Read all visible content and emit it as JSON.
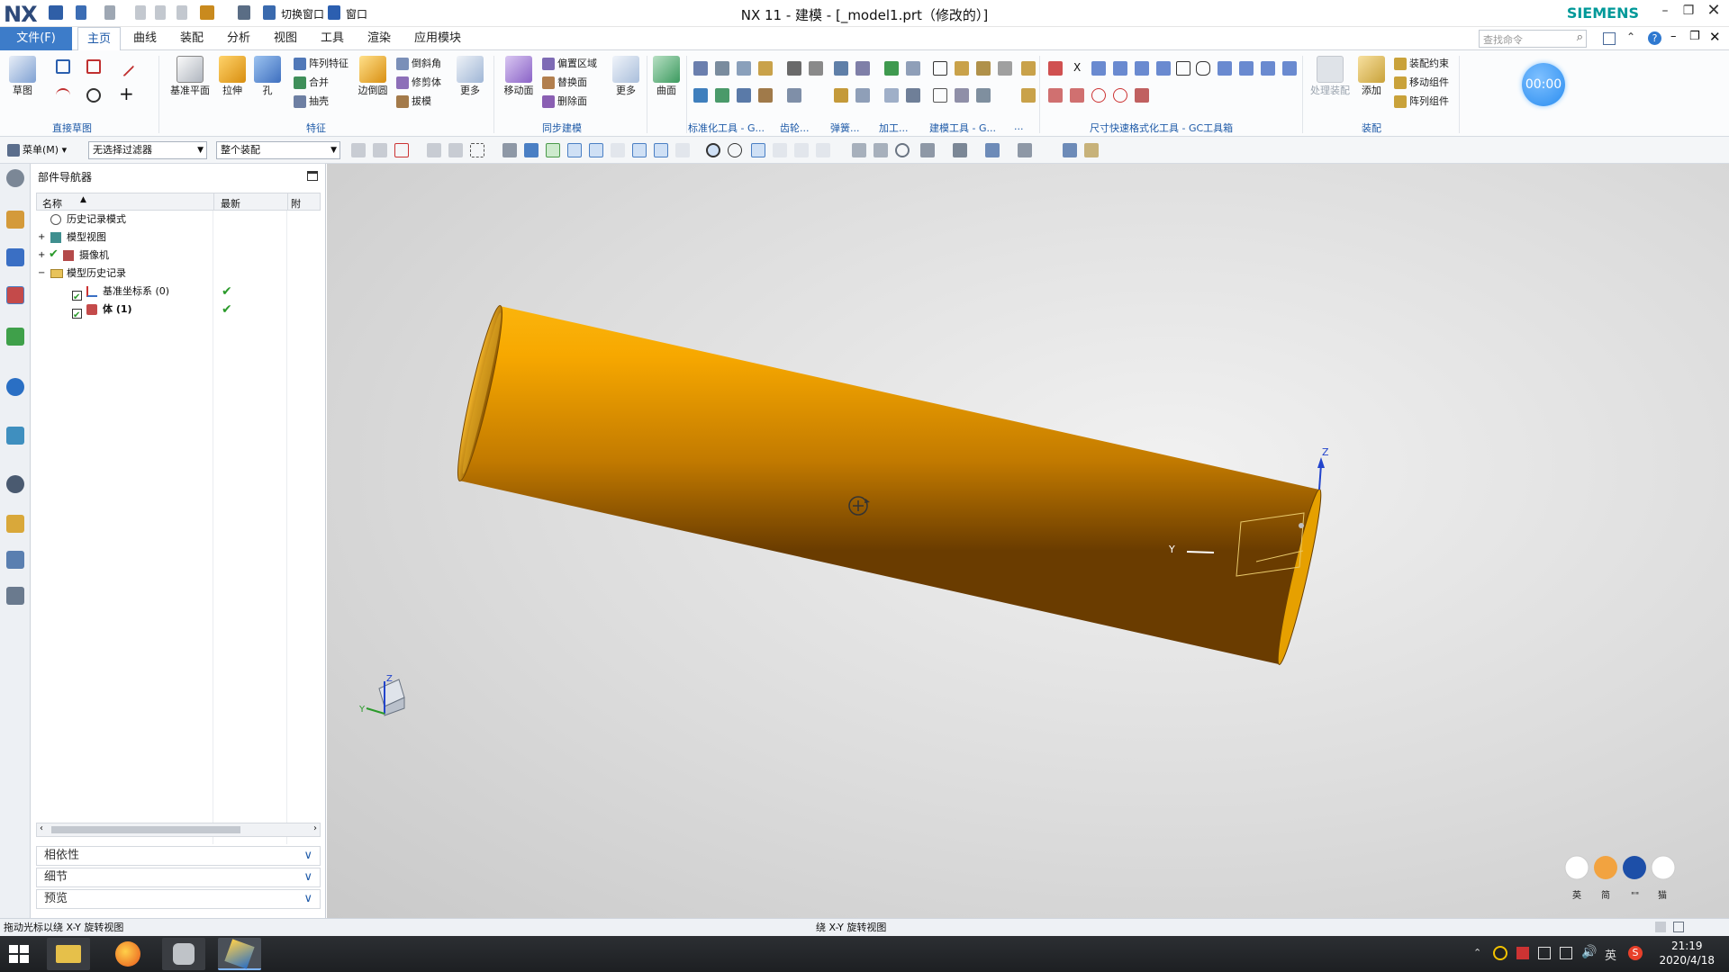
{
  "window": {
    "title": "NX 11 - 建模 - [_model1.prt（修改的）]",
    "brand": "SIEMENS",
    "logo": "NX",
    "quick_switch": "切换窗口",
    "quick_window": "窗口"
  },
  "menu_tabs": [
    "文件(F)",
    "主页",
    "曲线",
    "装配",
    "分析",
    "视图",
    "工具",
    "渲染",
    "应用模块"
  ],
  "search": {
    "placeholder": "查找命令"
  },
  "timer": "00:00",
  "ribbon": {
    "sketch": "草图",
    "direct_sketch_group": "直接草图",
    "datum_plane": "基准平面",
    "extrude": "拉伸",
    "hole": "孔",
    "pattern_feature": "阵列特征",
    "unite": "合并",
    "shell": "抽壳",
    "edge_blend": "边倒圆",
    "chamfer": "倒斜角",
    "trim_body": "修剪体",
    "draft": "拔模",
    "more": "更多",
    "feature_group": "特征",
    "move_face": "移动面",
    "offset_region": "偏置区域",
    "replace_face": "替换面",
    "delete_face": "删除面",
    "sync_more": "更多",
    "sync_group": "同步建模",
    "surface": "曲面",
    "std_tools_group": "标准化工具 - G...",
    "gear_group": "齿轮...",
    "spring_group": "弹簧...",
    "machining_group": "加工...",
    "modeling_tools_group": "建模工具 - G...",
    "dim_group_short": "...",
    "dim_format_group": "尺寸快速格式化工具 - GC工具箱",
    "assembly_process": "处理装配",
    "add": "添加",
    "assembly_constraint": "装配约束",
    "move_component": "移动组件",
    "pattern_component": "阵列组件",
    "assembly_group": "装配"
  },
  "toolbar": {
    "menu": "菜单(M)",
    "filter": "无选择过滤器",
    "scope": "整个装配"
  },
  "navigator": {
    "title": "部件导航器",
    "col_name": "名称",
    "col_latest": "最新",
    "col_more": "附",
    "rows": [
      {
        "label": "历史记录模式"
      },
      {
        "label": "模型视图"
      },
      {
        "label": "摄像机"
      },
      {
        "label": "模型历史记录"
      },
      {
        "label": "基准坐标系 (0)"
      },
      {
        "label": "体 (1)"
      }
    ],
    "panels": [
      "相依性",
      "细节",
      "预览"
    ]
  },
  "viewport": {
    "axis_z": "Z",
    "axis_y": "Y",
    "triad_z": "Z",
    "triad_y": "Y",
    "body_color": "#f5a400"
  },
  "ime_row": [
    "英",
    "简",
    "\"\"",
    "猫"
  ],
  "status": {
    "left": "拖动光标以绕 X-Y 旋转视图",
    "center": "绕 X-Y 旋转视图"
  },
  "taskbar": {
    "time": "21:19",
    "date": "2020/4/18",
    "ime_indicator": "英"
  }
}
